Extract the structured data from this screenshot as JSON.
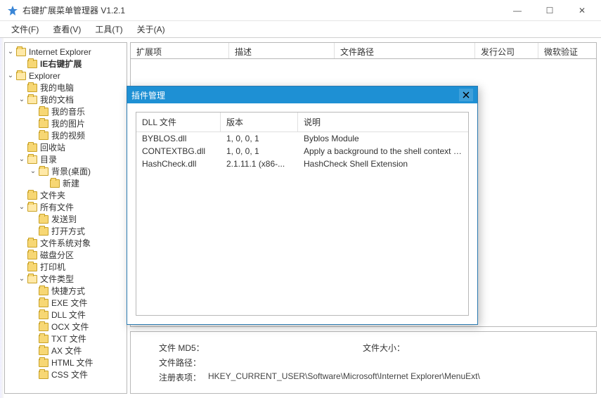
{
  "window": {
    "title": "右键扩展菜单管理器 V1.2.1"
  },
  "win_controls": {
    "min": "—",
    "max": "☐",
    "close": "✕"
  },
  "menu": [
    {
      "label": "文件(F)"
    },
    {
      "label": "查看(V)"
    },
    {
      "label": "工具(T)"
    },
    {
      "label": "关于(A)"
    }
  ],
  "main_list": {
    "columns": [
      "扩展项",
      "描述",
      "文件路径",
      "发行公司",
      "微软验证"
    ]
  },
  "details": {
    "md5_label": "文件 MD5：",
    "size_label": "文件大小：",
    "path_label": "文件路径：",
    "reg_label": "注册表项：",
    "reg_value": "HKEY_CURRENT_USER\\Software\\Microsoft\\Internet Explorer\\MenuExt\\"
  },
  "tree": {
    "ie": "Internet Explorer",
    "ie_ext": "IE右键扩展",
    "explorer": "Explorer",
    "my_computer": "我的电脑",
    "my_docs": "我的文档",
    "my_music": "我的音乐",
    "my_pic": "我的图片",
    "my_video": "我的视频",
    "recycle": "回收站",
    "directory": "目录",
    "background": "背景(桌面)",
    "new": "新建",
    "folders": "文件夹",
    "all_files": "所有文件",
    "send_to": "发送到",
    "open_with": "打开方式",
    "fs_objects": "文件系统对象",
    "partitions": "磁盘分区",
    "printers": "打印机",
    "file_types": "文件类型",
    "shortcut": "快捷方式",
    "exe": "EXE 文件",
    "dll": "DLL 文件",
    "ocx": "OCX 文件",
    "txt": "TXT 文件",
    "ax": "AX 文件",
    "html": "HTML 文件",
    "css": "CSS 文件"
  },
  "modal": {
    "title": "插件管理",
    "columns": [
      "DLL 文件",
      "版本",
      "说明"
    ],
    "rows": [
      {
        "file": "BYBLOS.dll",
        "ver": "1, 0, 0, 1",
        "desc": "Byblos Module"
      },
      {
        "file": "CONTEXTBG.dll",
        "ver": "1, 0, 0, 1",
        "desc": "Apply a background to the shell context menu"
      },
      {
        "file": "HashCheck.dll",
        "ver": "2.1.11.1 (x86-...",
        "desc": "HashCheck Shell Extension"
      }
    ]
  }
}
